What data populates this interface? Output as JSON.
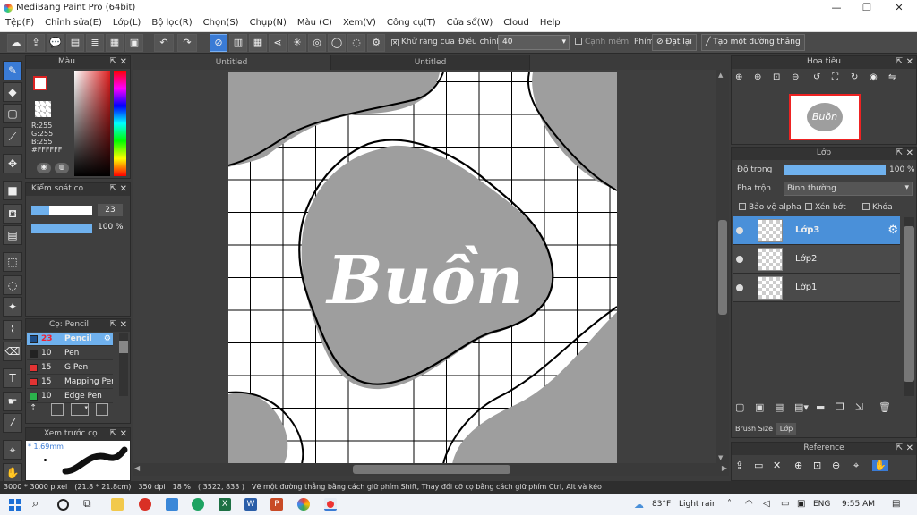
{
  "window": {
    "title": "MediBang Paint Pro (64bit)",
    "minimize": "—",
    "maximize": "❐",
    "close": "✕"
  },
  "menu": [
    "Tệp(F)",
    "Chỉnh sửa(E)",
    "Lớp(L)",
    "Bộ lọc(R)",
    "Chọn(S)",
    "Chụp(N)",
    "Màu (C)",
    "Xem(V)",
    "Công cụ(T)",
    "Cửa sổ(W)",
    "Cloud",
    "Help"
  ],
  "toolbar": {
    "antialias": "Khử răng cưa",
    "correction_label": "Điều chỉnh",
    "correction_value": "40",
    "soft_edge": "Cạnh mềm",
    "key_label": "Phím",
    "reset": "Đặt lại",
    "create_line": "Tạo một đường thẳng"
  },
  "tabs": [
    "Untitled",
    "Untitled"
  ],
  "color_panel": {
    "title": "Màu",
    "r": "R:255",
    "g": "G:255",
    "b": "B:255",
    "hex": "#FFFFFF"
  },
  "brush_control": {
    "title": "Kiểm soát cọ",
    "size": "23",
    "opacity": "100 %",
    "size_fraction": 0.3,
    "opacity_fraction": 1.0
  },
  "brush_panel": {
    "title": "Cọ: Pencil",
    "items": [
      {
        "size": "23",
        "name": "Pencil",
        "color": "#1e4f8a",
        "selected": true
      },
      {
        "size": "10",
        "name": "Pen",
        "color": "#222222",
        "selected": false
      },
      {
        "size": "15",
        "name": "G Pen",
        "color": "#e23333",
        "selected": false
      },
      {
        "size": "15",
        "name": "Mapping Pen",
        "color": "#e23333",
        "selected": false
      },
      {
        "size": "10",
        "name": "Edge Pen",
        "color": "#2bb24c",
        "selected": false
      }
    ]
  },
  "preview_panel": {
    "title": "Xem trước cọ",
    "size": "* 1.69mm"
  },
  "navigator": {
    "title": "Hoa tiêu"
  },
  "layer_panel": {
    "title": "Lớp",
    "opacity_label": "Độ trong",
    "opacity_value": "100 %",
    "opacity_fraction": 1.0,
    "blend_label": "Pha trộn",
    "blend_value": "Bình thường",
    "protect_alpha": "Bảo vệ alpha",
    "clipping": "Xén bớt",
    "lock": "Khóa",
    "layers": [
      {
        "name": "Lớp3",
        "selected": true
      },
      {
        "name": "Lớp2",
        "selected": false
      },
      {
        "name": "Lớp1",
        "selected": false
      }
    ],
    "bottom_tabs": [
      "Brush Size",
      "Lớp"
    ]
  },
  "reference_panel": {
    "title": "Reference"
  },
  "canvas": {
    "word": "Buồn"
  },
  "status": {
    "size": "3000 * 3000 pixel",
    "cm": "(21.8 * 21.8cm)",
    "dpi": "350 dpi",
    "zoom": "18 %",
    "coords": "( 3522, 833 )",
    "hint": "Vẽ một đường thẳng bằng cách giữ phím Shift, Thay đổi cỡ cọ bằng cách giữ phím Ctrl, Alt và kéo"
  },
  "taskbar": {
    "temp": "83°F",
    "weather": "Light rain",
    "lang": "ENG",
    "time": "9:55 AM"
  }
}
